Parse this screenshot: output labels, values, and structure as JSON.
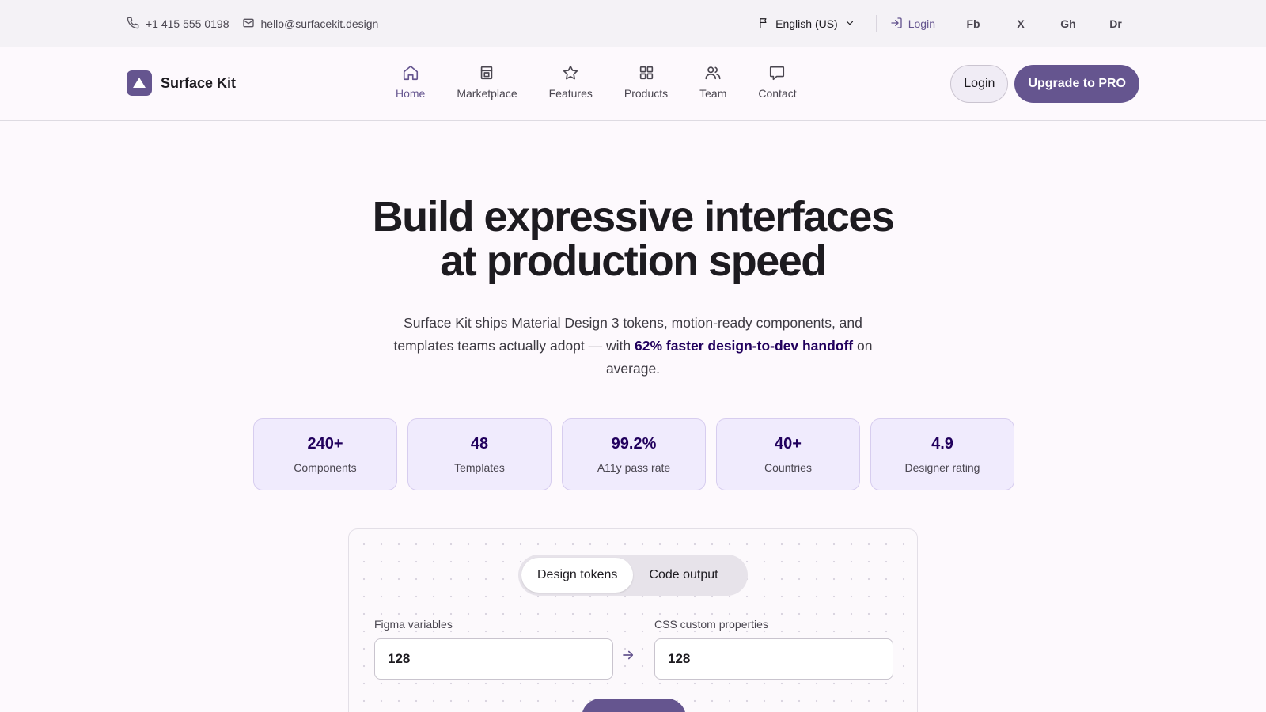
{
  "topbar": {
    "phone": "+1 415 555 0198",
    "email": "hello@surfacekit.design",
    "language": "English (US)",
    "login": "Login",
    "socials": [
      "Fb",
      "X",
      "Gh",
      "Dr"
    ]
  },
  "nav": {
    "brand": "Surface Kit",
    "items": [
      {
        "label": "Home",
        "icon": "home-icon",
        "active": true
      },
      {
        "label": "Marketplace",
        "icon": "store-icon"
      },
      {
        "label": "Features",
        "icon": "star-icon"
      },
      {
        "label": "Products",
        "icon": "grid-icon"
      },
      {
        "label": "Team",
        "icon": "users-icon"
      },
      {
        "label": "Contact",
        "icon": "message-icon"
      }
    ],
    "login_button": "Login",
    "upgrade_button": "Upgrade to PRO"
  },
  "hero": {
    "title_line1": "Build expressive interfaces",
    "title_line2": "at production speed",
    "subtitle_pre": "Surface Kit ships Material Design 3 tokens, motion-ready components, and templates teams actually adopt — with ",
    "subtitle_highlight": "62% faster design-to-dev handoff",
    "subtitle_post": " on average."
  },
  "stats": [
    {
      "value": "240+",
      "label": "Components"
    },
    {
      "value": "48",
      "label": "Templates"
    },
    {
      "value": "99.2%",
      "label": "A11y pass rate"
    },
    {
      "value": "40+",
      "label": "Countries"
    },
    {
      "value": "4.9",
      "label": "Designer rating"
    }
  ],
  "converter": {
    "tabs": [
      "Design tokens",
      "Code output"
    ],
    "active_tab": "Design tokens",
    "left_label": "Figma variables",
    "left_value": "128",
    "right_label": "CSS custom properties",
    "right_value": "128"
  },
  "colors": {
    "primary": "#65558f",
    "on_primary_container": "#21005d",
    "stat_container": "#f0ebfd",
    "surface": "#fdf9fd"
  }
}
